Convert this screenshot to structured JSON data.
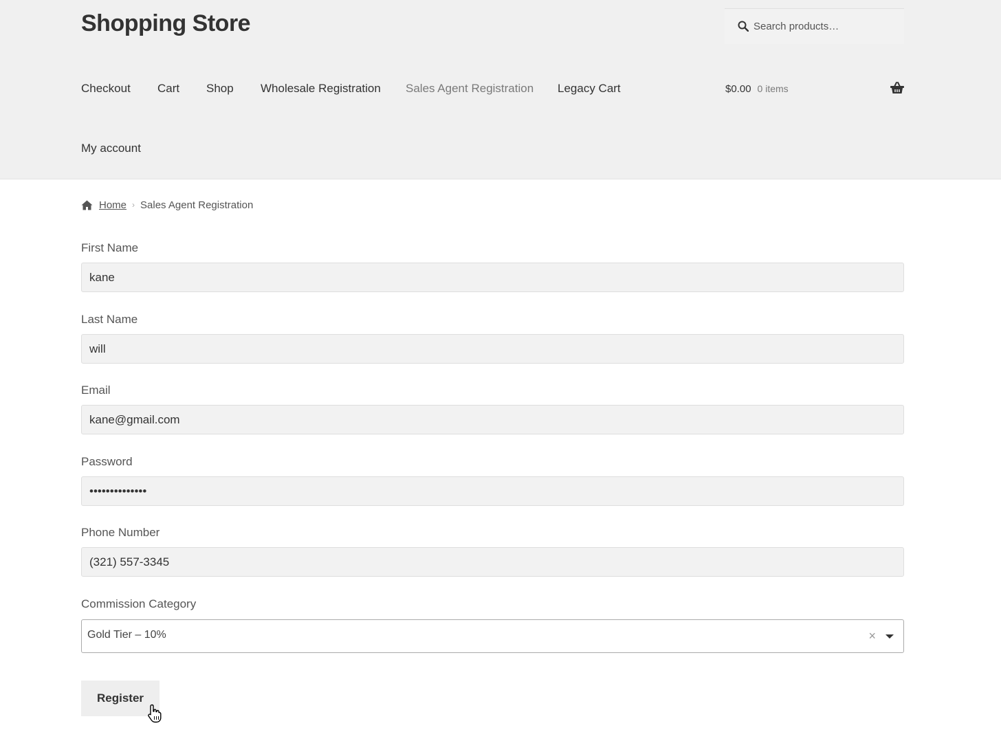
{
  "site": {
    "title": "Shopping Store"
  },
  "search": {
    "placeholder": "Search products…"
  },
  "nav": {
    "items": [
      {
        "label": "Checkout"
      },
      {
        "label": "Cart"
      },
      {
        "label": "Shop"
      },
      {
        "label": "Wholesale Registration"
      },
      {
        "label": "Sales Agent Registration"
      },
      {
        "label": "Legacy Cart"
      },
      {
        "label": "My account"
      }
    ],
    "current": "Sales Agent Registration"
  },
  "cart": {
    "amount": "$0.00",
    "count": "0 items"
  },
  "breadcrumb": {
    "home": "Home",
    "separator": "›",
    "current": "Sales Agent Registration"
  },
  "form": {
    "first_name": {
      "label": "First Name",
      "value": "kane"
    },
    "last_name": {
      "label": "Last Name",
      "value": "will"
    },
    "email": {
      "label": "Email",
      "value": "kane@gmail.com"
    },
    "password": {
      "label": "Password",
      "value": "••••••••••••••"
    },
    "phone": {
      "label": "Phone Number",
      "value": "(321) 557-3345"
    },
    "commission": {
      "label": "Commission Category",
      "selected": "Gold Tier – 10%",
      "clear": "×"
    },
    "submit_label": "Register"
  },
  "icons": {
    "search": "search-icon",
    "basket": "basket-icon",
    "home": "home-icon",
    "cursor": "hand-pointer-icon",
    "dropdown": "chevron-down-icon"
  },
  "colors": {
    "header_bg": "#f0f0f0",
    "input_bg": "#f2f2f2",
    "text": "#333333",
    "muted": "#7a7a7a",
    "button_bg": "#eeeeee"
  }
}
